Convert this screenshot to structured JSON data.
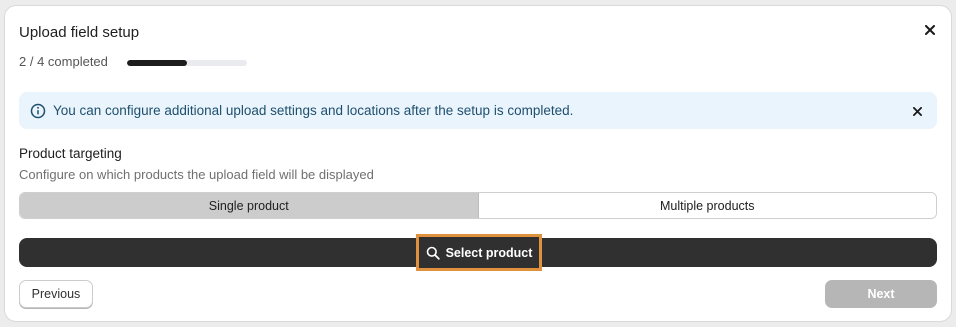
{
  "modal": {
    "title": "Upload field setup",
    "close_icon": "close-icon"
  },
  "progress": {
    "label": "2 / 4 completed",
    "completed": 2,
    "total": 4,
    "fill_color": "#1d1d1d"
  },
  "banner": {
    "icon": "info-icon",
    "text": "You can configure additional upload settings and locations after the setup is completed.",
    "close_icon": "close-icon",
    "background": "#eaf4fc"
  },
  "targeting": {
    "title": "Product targeting",
    "subtitle": "Configure on which products the upload field will be displayed",
    "options": [
      {
        "label": "Single product",
        "selected": true
      },
      {
        "label": "Multiple products",
        "selected": false
      }
    ]
  },
  "select_product": {
    "icon": "search-icon",
    "label": "Select product",
    "highlight_color": "#e0913d"
  },
  "footer": {
    "previous_label": "Previous",
    "next_label": "Next",
    "next_enabled": false
  }
}
